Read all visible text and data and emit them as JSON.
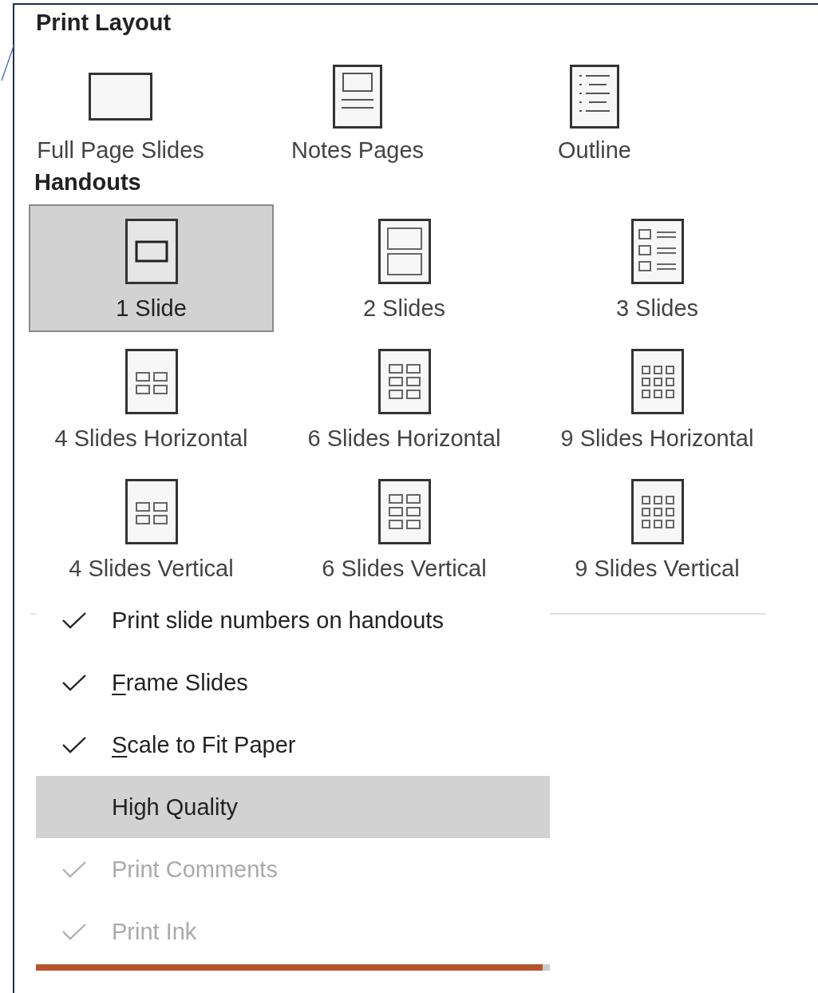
{
  "print_layout": {
    "title": "Print Layout",
    "items": [
      {
        "label": "Full Page Slides",
        "selected": false
      },
      {
        "label": "Notes Pages",
        "selected": false
      },
      {
        "label": "Outline",
        "selected": false
      }
    ]
  },
  "handouts": {
    "title": "Handouts",
    "items": [
      {
        "label": "1 Slide",
        "selected": true
      },
      {
        "label": "2 Slides",
        "selected": false
      },
      {
        "label": "3 Slides",
        "selected": false
      },
      {
        "label": "4 Slides Horizontal",
        "selected": false
      },
      {
        "label": "6 Slides Horizontal",
        "selected": false
      },
      {
        "label": "9 Slides Horizontal",
        "selected": false
      },
      {
        "label": "4 Slides Vertical",
        "selected": false
      },
      {
        "label": "6 Slides Vertical",
        "selected": false
      },
      {
        "label": "9 Slides Vertical",
        "selected": false
      }
    ]
  },
  "options": [
    {
      "label": "Print slide numbers on handouts",
      "checked": true,
      "disabled": false,
      "selected": false,
      "underline_first": false
    },
    {
      "label": "Frame Slides",
      "checked": true,
      "disabled": false,
      "selected": false,
      "underline_first": true
    },
    {
      "label": "Scale to Fit Paper",
      "checked": true,
      "disabled": false,
      "selected": false,
      "underline_first": true
    },
    {
      "label": "High Quality",
      "checked": false,
      "disabled": false,
      "selected": true,
      "underline_first": false
    },
    {
      "label": "Print Comments",
      "checked": true,
      "disabled": true,
      "selected": false,
      "underline_first": false
    },
    {
      "label": "Print Ink",
      "checked": true,
      "disabled": true,
      "selected": false,
      "underline_first": false
    }
  ]
}
